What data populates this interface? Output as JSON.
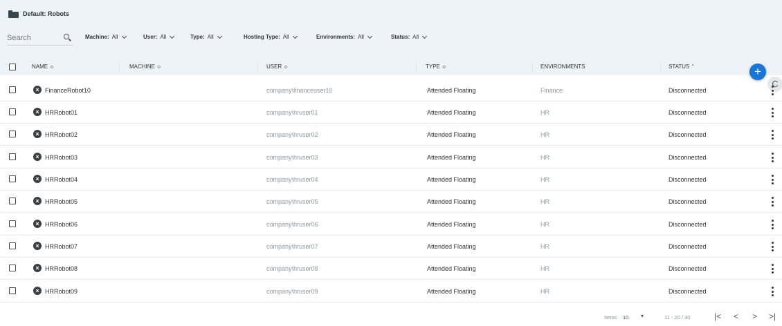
{
  "breadcrumb": {
    "text": "Default: Robots"
  },
  "search": {
    "placeholder": "Search"
  },
  "filters": [
    {
      "label": "Machine:",
      "value": "All"
    },
    {
      "label": "User:",
      "value": "All"
    },
    {
      "label": "Type:",
      "value": "All"
    },
    {
      "label": "Hosting Type:",
      "value": "All"
    },
    {
      "label": "Environments:",
      "value": "All"
    },
    {
      "label": "Status:",
      "value": "All"
    }
  ],
  "actions": {
    "add": "+",
    "refresh": "C"
  },
  "columns": {
    "name": "NAME",
    "machine": "MACHINE",
    "user": "USER",
    "type": "TYPE",
    "environments": "ENVIRONMENTS",
    "status": "STATUS"
  },
  "sort_glyphs": {
    "both": "≎",
    "asc": "^"
  },
  "rows": [
    {
      "name": "FinanceRobot10",
      "machine": "",
      "user": "company\\financeuser10",
      "type": "Attended Floating",
      "environment": "Finance",
      "status": "Disconnected"
    },
    {
      "name": "HRRobot01",
      "machine": "",
      "user": "company\\hruser01",
      "type": "Attended Floating",
      "environment": "HR",
      "status": "Disconnected"
    },
    {
      "name": "HRRobot02",
      "machine": "",
      "user": "company\\hruser02",
      "type": "Attended Floating",
      "environment": "HR",
      "status": "Disconnected"
    },
    {
      "name": "HRRobot03",
      "machine": "",
      "user": "company\\hruser03",
      "type": "Attended Floating",
      "environment": "HR",
      "status": "Disconnected"
    },
    {
      "name": "HRRobot04",
      "machine": "",
      "user": "company\\hruser04",
      "type": "Attended Floating",
      "environment": "HR",
      "status": "Disconnected"
    },
    {
      "name": "HRRobot05",
      "machine": "",
      "user": "company\\hruser05",
      "type": "Attended Floating",
      "environment": "HR",
      "status": "Disconnected"
    },
    {
      "name": "HRRobot06",
      "machine": "",
      "user": "company\\hruser06",
      "type": "Attended Floating",
      "environment": "HR",
      "status": "Disconnected"
    },
    {
      "name": "HRRobot07",
      "machine": "",
      "user": "company\\hruser07",
      "type": "Attended Floating",
      "environment": "HR",
      "status": "Disconnected"
    },
    {
      "name": "HRRobot08",
      "machine": "",
      "user": "company\\hruser08",
      "type": "Attended Floating",
      "environment": "HR",
      "status": "Disconnected"
    },
    {
      "name": "HRRobot09",
      "machine": "",
      "user": "company\\hruser09",
      "type": "Attended Floating",
      "environment": "HR",
      "status": "Disconnected"
    }
  ],
  "pagination": {
    "items_label": "Items",
    "page_size": "10",
    "range": "11 - 20 / 30",
    "first": "|<",
    "prev": "<",
    "next": ">",
    "last": ">|"
  },
  "colors": {
    "accent": "#1976d2",
    "header_band": "#edf3f8",
    "muted_text": "#9098a0"
  }
}
